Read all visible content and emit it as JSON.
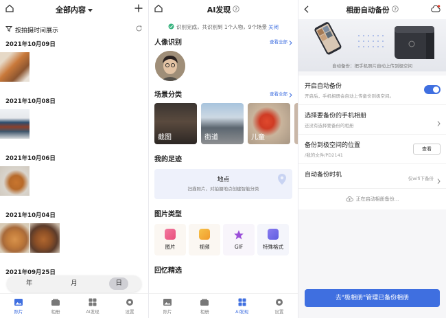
{
  "colors": {
    "accent": "#3f6fe0",
    "toggle_on": "#3f6fe0"
  },
  "screen1": {
    "title": "全部内容",
    "sort_label": "按拍摄时间展示",
    "groups": [
      {
        "date": "2021年10月09日"
      },
      {
        "date": "2021年10月08日"
      },
      {
        "date": "2021年10月06日"
      },
      {
        "date": "2021年10月04日"
      },
      {
        "date": "2021年09月25日"
      }
    ],
    "segments": [
      "年",
      "月",
      "日"
    ],
    "segment_selected": "日",
    "nav": [
      "照片",
      "相册",
      "AI发现",
      "设置"
    ],
    "nav_active": "照片"
  },
  "screen2": {
    "title": "AI发现",
    "notice": "识别完成，共识别到 1个人物，9个场景",
    "notice_close": "关闭",
    "people": {
      "title": "人像识别",
      "more": "查看全部"
    },
    "scenes": {
      "title": "场景分类",
      "more": "查看全部",
      "items": [
        "截图",
        "街道",
        "儿童"
      ]
    },
    "footprint": {
      "title": "我的足迹",
      "card_title": "地点",
      "card_desc": "扫描照片，对拍摄地点创建智能分类"
    },
    "types": {
      "title": "图片类型",
      "items": [
        "图片",
        "视频",
        "GIF",
        "特殊格式"
      ]
    },
    "memories": {
      "title": "回忆精选"
    },
    "nav": [
      "照片",
      "相册",
      "AI发现",
      "设置"
    ],
    "nav_active": "AI发现"
  },
  "screen3": {
    "title": "相册自动备份",
    "hero_caption": "自动备份：把手机照片自动上传到极空间",
    "rows": {
      "auto_backup": {
        "title": "开启自动备份",
        "desc": "开启后，手机相册会自动上传备份到极空间。",
        "enabled": true
      },
      "choose_album": {
        "title": "选择要备份的手机相册",
        "desc": "还没有选择要备份的相册"
      },
      "location": {
        "title": "备份到极空间的位置",
        "desc": "/我的文件/PD2141",
        "button": "查看"
      },
      "timing": {
        "title": "自动备份时机",
        "value": "仅wifi下备份"
      }
    },
    "status": "正在启动相册备份...",
    "cta": "去\"极相册\"管理已备份相册"
  }
}
